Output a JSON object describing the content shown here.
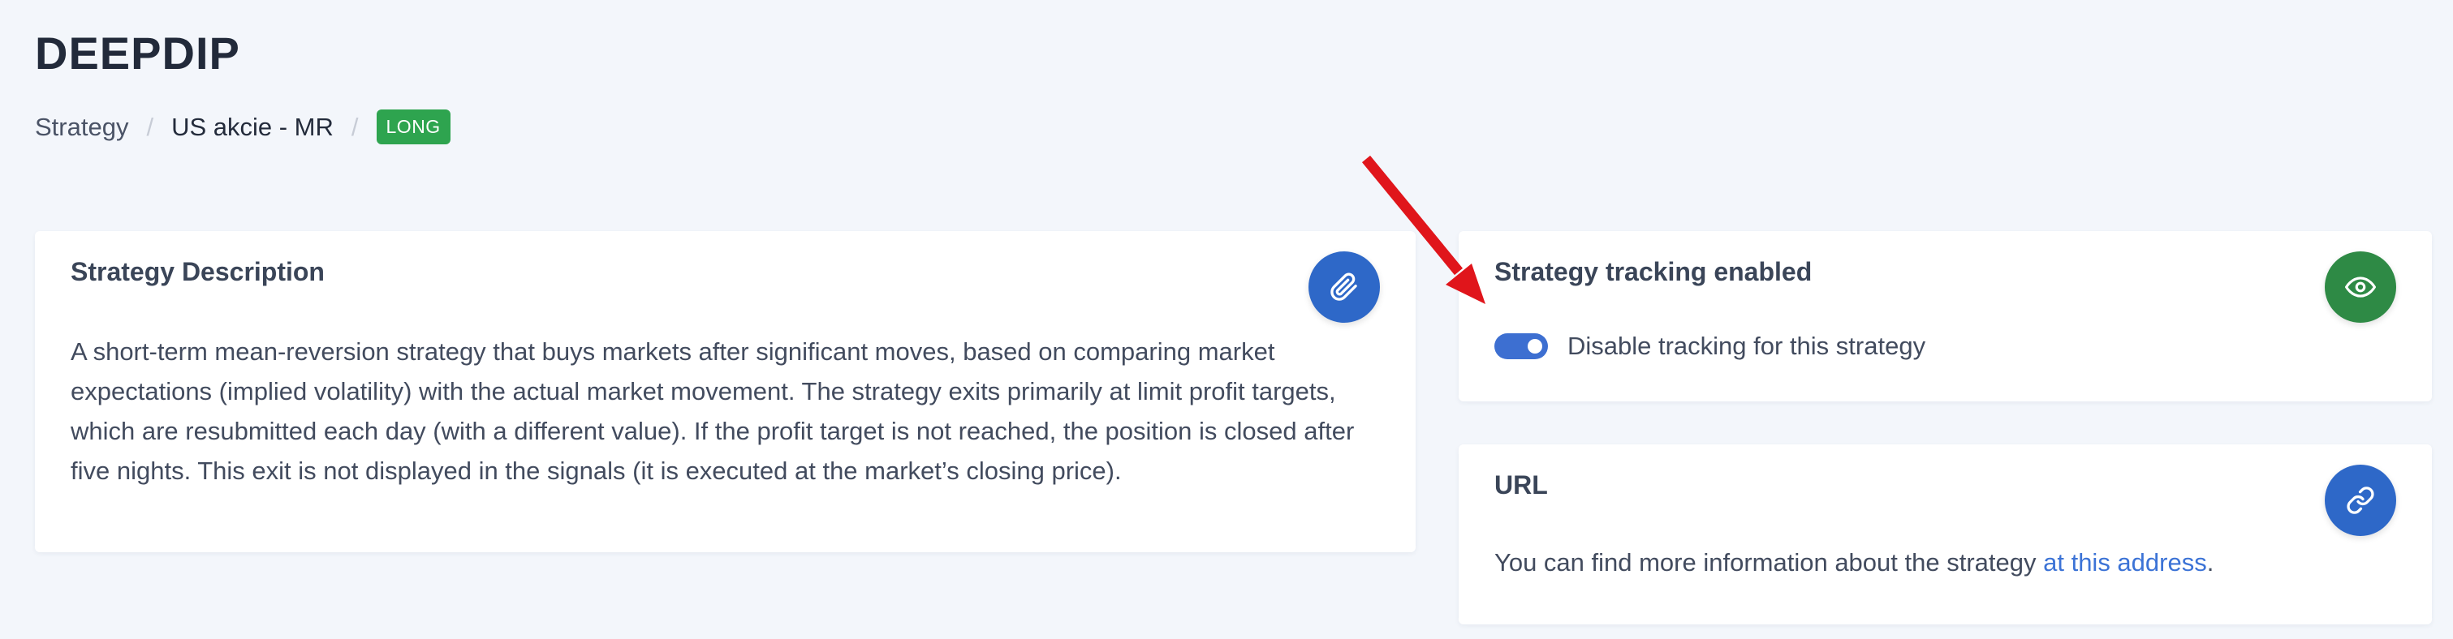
{
  "page": {
    "title": "DEEPDIP"
  },
  "breadcrumb": {
    "items": [
      "Strategy",
      "US akcie - MR"
    ],
    "separator": "/",
    "badge": "LONG",
    "badge_color": "#2ea44f"
  },
  "description_card": {
    "title": "Strategy Description",
    "text": "A short-term mean-reversion strategy that buys markets after significant moves, based on comparing market expectations (implied volatility) with the actual market movement. The strategy exits primarily at limit profit targets, which are resubmitted each day (with a different value). If the profit target is not reached, the position is closed after five nights. This exit is not displayed in the signals (it is executed at the market’s closing price).",
    "action_icon": "paperclip-icon",
    "action_color": "#2e68c8"
  },
  "tracking_card": {
    "title": "Strategy tracking enabled",
    "toggle_label": "Disable tracking for this strategy",
    "toggle_on": true,
    "action_icon": "eye-icon",
    "action_color": "#2e8a45"
  },
  "url_card": {
    "title": "URL",
    "text_prefix": "You can find more information about the strategy ",
    "link_text": "at this address",
    "text_suffix": ".",
    "action_icon": "link-icon",
    "action_color": "#2e68c8"
  },
  "annotation": {
    "color": "#e0151b"
  },
  "colors": {
    "background": "#f3f6fb",
    "accent_blue": "#3d6fd1",
    "link": "#3c73d6"
  }
}
